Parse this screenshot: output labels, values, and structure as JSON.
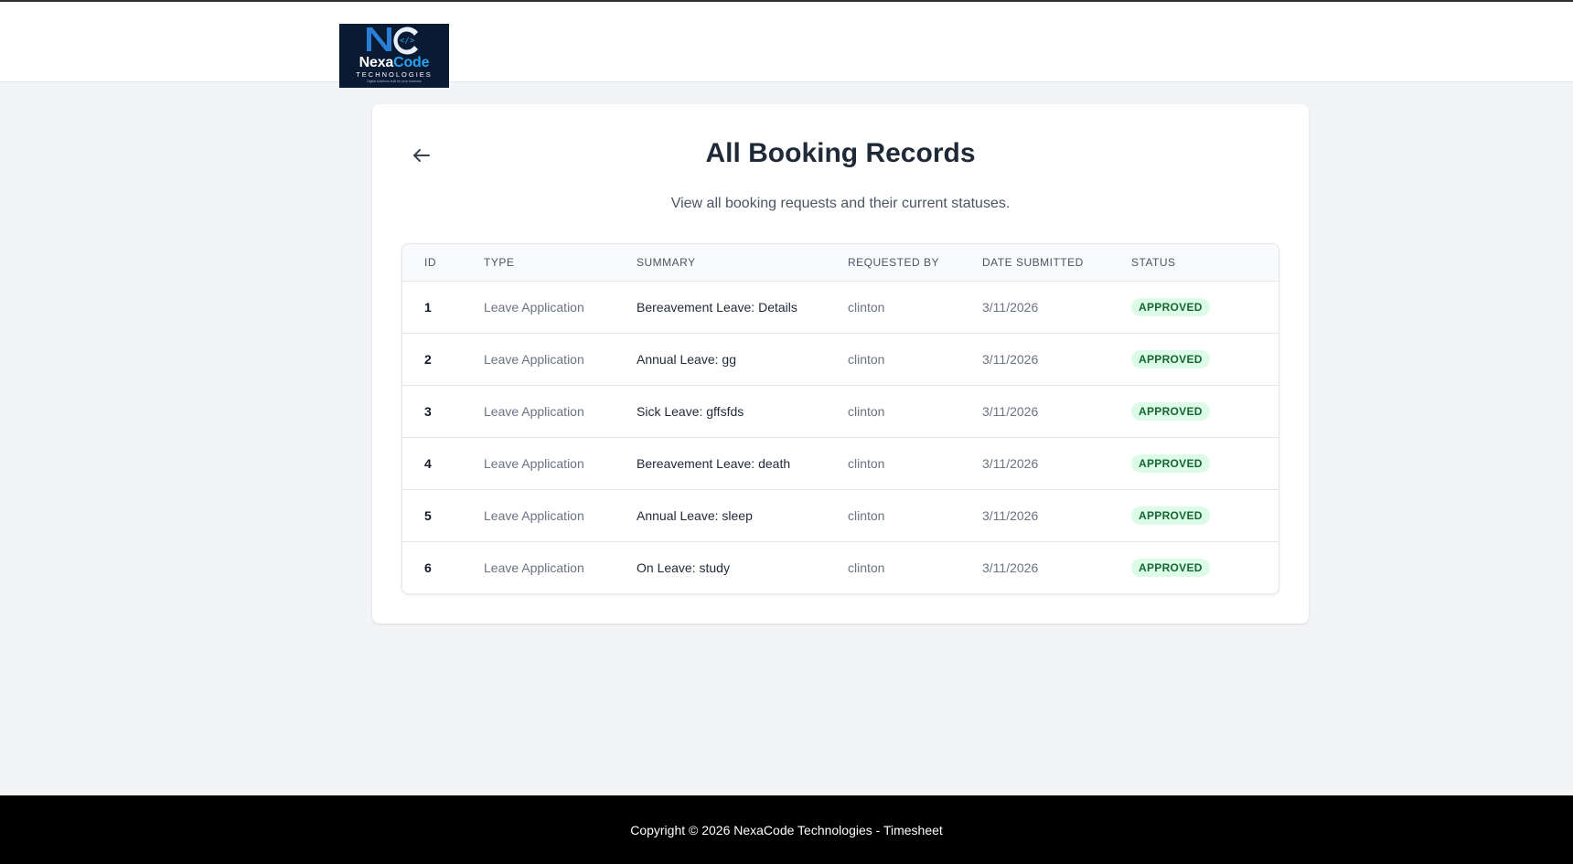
{
  "brand": {
    "logo_word_left": "Nexa",
    "logo_word_right": "Code",
    "logo_sub": "TECHNOLOGIES",
    "logo_tagline": "Digital solutions built for your business"
  },
  "page": {
    "title": "All Booking Records",
    "subtitle": "View all booking requests and their current statuses."
  },
  "table": {
    "headers": [
      "ID",
      "TYPE",
      "SUMMARY",
      "REQUESTED BY",
      "DATE SUBMITTED",
      "STATUS"
    ],
    "rows": [
      {
        "id": "1",
        "type": "Leave Application",
        "summary": "Bereavement Leave: Details",
        "requested_by": "clinton",
        "date": "3/11/2026",
        "status": "APPROVED"
      },
      {
        "id": "2",
        "type": "Leave Application",
        "summary": "Annual Leave: gg",
        "requested_by": "clinton",
        "date": "3/11/2026",
        "status": "APPROVED"
      },
      {
        "id": "3",
        "type": "Leave Application",
        "summary": "Sick Leave: gffsfds",
        "requested_by": "clinton",
        "date": "3/11/2026",
        "status": "APPROVED"
      },
      {
        "id": "4",
        "type": "Leave Application",
        "summary": "Bereavement Leave: death",
        "requested_by": "clinton",
        "date": "3/11/2026",
        "status": "APPROVED"
      },
      {
        "id": "5",
        "type": "Leave Application",
        "summary": "Annual Leave: sleep",
        "requested_by": "clinton",
        "date": "3/11/2026",
        "status": "APPROVED"
      },
      {
        "id": "6",
        "type": "Leave Application",
        "summary": "On Leave: study",
        "requested_by": "clinton",
        "date": "3/11/2026",
        "status": "APPROVED"
      }
    ]
  },
  "footer": {
    "copyright": "Copyright © 2026 NexaCode Technologies - Timesheet"
  },
  "colors": {
    "approved_bg": "#dcfce7",
    "approved_text": "#166534",
    "footer_bg": "#000000",
    "logo_bg": "#0b1a33",
    "logo_accent": "#29a3ef"
  },
  "icons": {
    "back": "arrow-left-icon"
  }
}
